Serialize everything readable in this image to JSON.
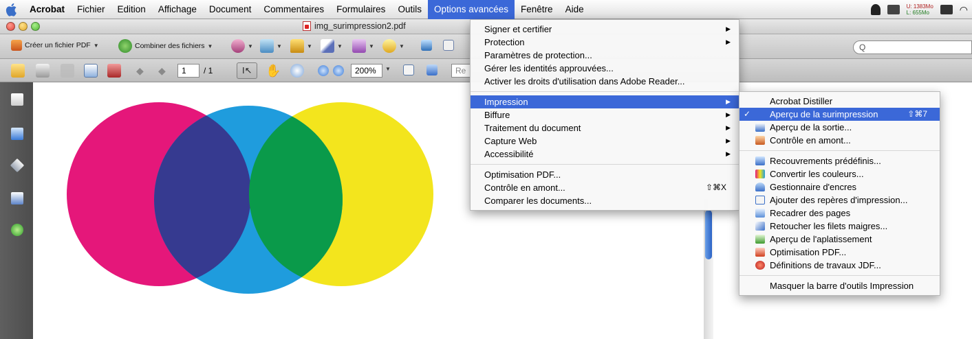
{
  "menubar": {
    "items": [
      "Acrobat",
      "Fichier",
      "Edition",
      "Affichage",
      "Document",
      "Commentaires",
      "Formulaires",
      "Outils",
      "Options avancées",
      "Fenêtre",
      "Aide"
    ],
    "memory": [
      "U: 1383Mo",
      "L: 655Mo"
    ]
  },
  "window": {
    "title": "img_surimpression2.pdf"
  },
  "toolbar": {
    "create_pdf": "Créer un fichier PDF",
    "combine": "Combiner des fichiers",
    "page_current": "1",
    "page_total": "/ 1",
    "zoom": "200%",
    "search_placeholder": "Q",
    "rech_label": "Re"
  },
  "advanced_menu": {
    "group1": [
      "Signer et certifier",
      "Protection",
      "Paramètres de protection...",
      "Gérer les identités approuvées...",
      "Activer les droits d'utilisation dans Adobe Reader..."
    ],
    "group2": [
      "Impression",
      "Biffure",
      "Traitement du document",
      "Capture Web",
      "Accessibilité"
    ],
    "group3": [
      "Optimisation PDF...",
      "Contrôle en amont...",
      "Comparer les documents..."
    ],
    "preflight_shortcut": "⇧⌘X"
  },
  "print_submenu": {
    "item1": "Acrobat Distiller",
    "checked": "Aperçu de la surimpression",
    "checked_shortcut": "⇧⌘7",
    "group1": [
      "Aperçu de la sortie...",
      "Contrôle en amont..."
    ],
    "group2": [
      "Recouvrements prédéfinis...",
      "Convertir les couleurs...",
      "Gestionnaire d'encres",
      "Ajouter des repères d'impression...",
      "Recadrer des pages",
      "Retoucher les filets maigres...",
      "Aperçu de l'aplatissement",
      "Optimisation PDF...",
      "Définitions de travaux JDF..."
    ],
    "hide_toolbar": "Masquer la barre d'outils Impression"
  },
  "colors": {
    "magenta": "#e5177a",
    "cyan": "#1f9cdd",
    "yellow": "#f3e51d",
    "overlap_mc": "#363a90",
    "overlap_cy": "#0a9a4a",
    "highlight": "#3b68d8"
  }
}
